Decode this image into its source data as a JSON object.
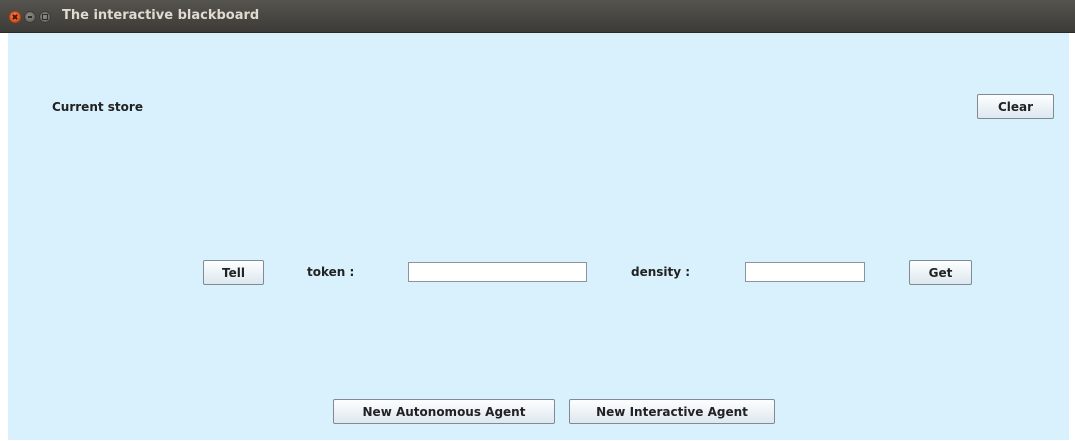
{
  "window": {
    "title": "The interactive blackboard"
  },
  "store": {
    "label": "Current store",
    "clear_label": "Clear"
  },
  "controls": {
    "tell_label": "Tell",
    "token_label": "token :",
    "token_value": "",
    "density_label": "density :",
    "density_value": "",
    "get_label": "Get"
  },
  "agents": {
    "autonomous_label": "New Autonomous Agent",
    "interactive_label": "New Interactive Agent"
  },
  "icons": {
    "close": "close-icon",
    "minimize": "minimize-icon",
    "maximize": "maximize-icon"
  },
  "colors": {
    "titlebar": "#3d3b37",
    "background": "#d9f1fc",
    "close_button": "#e2531b"
  }
}
